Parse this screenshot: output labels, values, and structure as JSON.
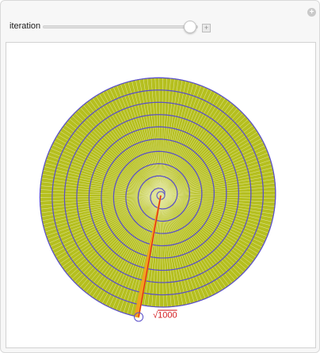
{
  "controls": {
    "slider_label": "iteration",
    "iteration": 1000,
    "iteration_max": 1000,
    "slider_fraction": 0.95
  },
  "icons": {
    "settings": "plus-circle-icon",
    "expand": "plus-square-icon"
  },
  "plot": {
    "root_label_prefix": "√",
    "root_label_value": "1000",
    "colors": {
      "triangle_fill": "#b5bf1f",
      "triangle_edge": "#e4e8a6",
      "spiral": "#5a4fc9",
      "hypotenuse": "#e0201b",
      "highlight": "#f0a21f",
      "label": "#d3181c"
    }
  }
}
